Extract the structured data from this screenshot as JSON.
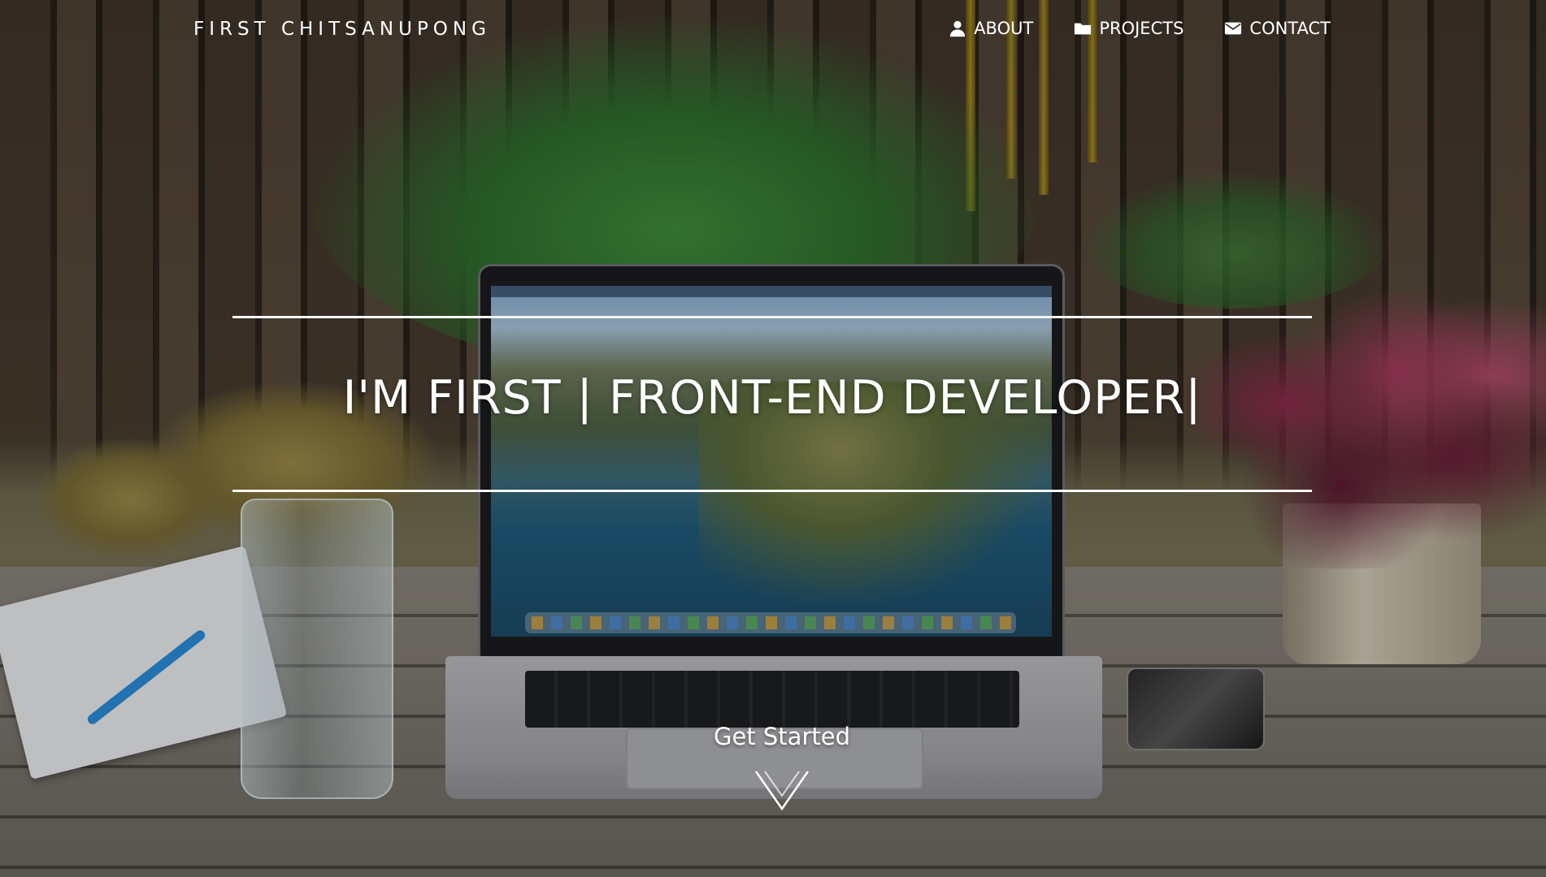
{
  "brand": {
    "name": "FIRST CHITSANUPONG"
  },
  "nav": {
    "items": [
      {
        "label": "ABOUT",
        "icon": "user-icon"
      },
      {
        "label": "PROJECTS",
        "icon": "folder-icon"
      },
      {
        "label": "CONTACT",
        "icon": "envelope-icon"
      }
    ]
  },
  "hero": {
    "headline": "I'M FIRST | FRONT-END DEVELOPER|",
    "cta_label": "Get Started",
    "cta_icon": "chevron-down-icon"
  },
  "colors": {
    "text": "#ffffff",
    "rule": "#f5f5f5"
  }
}
